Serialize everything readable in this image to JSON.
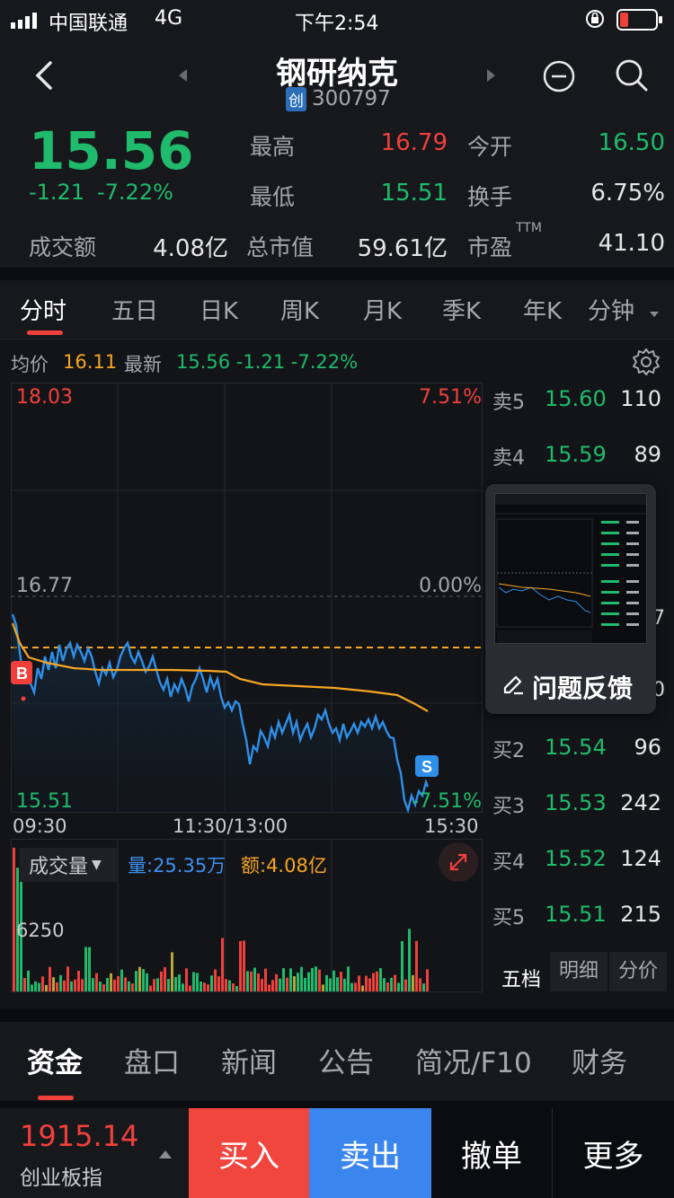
{
  "status_bar": {
    "carrier": "中国联通",
    "network": "4G",
    "time": "下午2:54"
  },
  "header": {
    "stock_name": "钢研纳克",
    "board_badge": "创",
    "stock_code": "300797"
  },
  "quote": {
    "price": "15.56",
    "change": "-1.21",
    "change_pct": "-7.22%",
    "high_label": "最高",
    "high": "16.79",
    "open_label": "今开",
    "open": "16.50",
    "low_label": "最低",
    "low": "15.51",
    "turnover_label": "换手",
    "turnover": "6.75%",
    "amount_label": "成交额",
    "amount": "4.08亿",
    "mcap_label": "总市值",
    "mcap": "59.61亿",
    "pe_label": "市盈",
    "pe_sup": "TTM",
    "pe": "41.10"
  },
  "period_tabs": [
    "分时",
    "五日",
    "日K",
    "周K",
    "月K",
    "季K",
    "年K",
    "分钟"
  ],
  "chart_info": {
    "avg_label": "均价",
    "avg": "16.11",
    "latest_label": "最新",
    "latest": "15.56 -1.21 -7.22%"
  },
  "chart_axis": {
    "top_price": "18.03",
    "top_pct": "7.51%",
    "mid_price": "16.77",
    "mid_pct": "0.00%",
    "bottom_price": "15.51",
    "bottom_pct": "-7.51%",
    "t_start": "09:30",
    "t_mid": "11:30/13:00",
    "t_end": "15:30",
    "buy_marker": "B",
    "sell_marker": "S"
  },
  "volume": {
    "selector": "成交量",
    "vol_label": "量:25.35万",
    "amt_label": "额:4.08亿",
    "scale": "6250"
  },
  "order_book": {
    "sell": [
      {
        "label": "卖5",
        "price": "15.60",
        "qty": "110"
      },
      {
        "label": "卖4",
        "price": "15.59",
        "qty": "89"
      }
    ],
    "buy": [
      {
        "label": "买2",
        "price": "15.54",
        "qty": "96"
      },
      {
        "label": "买3",
        "price": "15.53",
        "qty": "242"
      },
      {
        "label": "买4",
        "price": "15.52",
        "qty": "124"
      },
      {
        "label": "买5",
        "price": "15.51",
        "qty": "215"
      }
    ],
    "partial_right_1": "7",
    "partial_right_2": "0",
    "tabs": [
      "五档",
      "明细",
      "分价"
    ]
  },
  "feedback_popup": {
    "label": "问题反馈"
  },
  "bottom_tabs": [
    "资金",
    "盘口",
    "新闻",
    "公告",
    "简况/F10",
    "财务"
  ],
  "bottom_bar": {
    "index_value": "1915.14",
    "index_name": "创业板指",
    "buy": "买入",
    "sell": "卖出",
    "cancel": "撤单",
    "more": "更多"
  },
  "colors": {
    "up": "#f0403c",
    "down": "#1fba6b",
    "avg_line": "#f5a623",
    "price_line": "#2f8fe8",
    "buy_btn": "#f1463e",
    "sell_btn": "#3a86ee"
  }
}
